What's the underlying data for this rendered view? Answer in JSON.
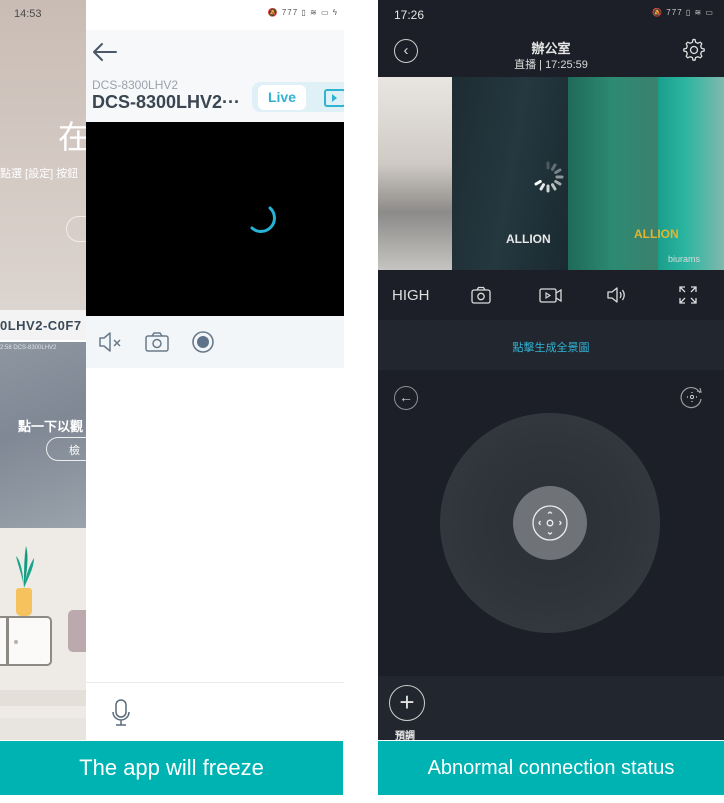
{
  "left_panel": {
    "background_app": {
      "status_time": "14:53",
      "banner_char": "在",
      "banner_hint": "點選 [設定] 按鈕",
      "device_name": "0LHV2-C0F7",
      "thumbnail_timestamp": "2:58  DCS-8300LHV2",
      "tap_hint": "點一下以觀",
      "check_button": "檢"
    },
    "app": {
      "status_icons": "🔕 777 ▯ ≋ ▭ ϟ",
      "back_icon": "arrow-left-icon",
      "device_model": "DCS-8300LHV2",
      "device_title": "DCS-8300LHV2···",
      "tabs": [
        {
          "label": "Live",
          "active": true
        },
        {
          "label": "",
          "icon": "playback-icon",
          "active": false
        }
      ],
      "video_state": "loading",
      "controls": [
        {
          "name": "mute",
          "icon": "speaker-muted-icon"
        },
        {
          "name": "snapshot",
          "icon": "camera-icon"
        },
        {
          "name": "record",
          "icon": "record-icon"
        }
      ],
      "mic_icon": "microphone-icon"
    },
    "caption": "The app will freeze"
  },
  "right_panel": {
    "status_time": "17:26",
    "status_icons": "🔕 777 ▯ ≋ ▭",
    "title": "辦公室",
    "subtitle": "直播 | 17:25:59",
    "video": {
      "state": "loading",
      "brand_text_1": "ALLION",
      "brand_text_2": "ALLION",
      "watermark": "biurams"
    },
    "toolbar": {
      "quality": "HIGH",
      "icons": [
        "camera-icon",
        "video-record-icon",
        "speaker-icon",
        "fullscreen-icon"
      ]
    },
    "panorama_label": "點擊生成全景圖",
    "ptz": {
      "back_icon": "arrow-left-circle-icon",
      "reset_icon": "ptz-reset-icon",
      "joystick_icon": "direction-pad-icon"
    },
    "preset_label": "預調",
    "caption": "Abnormal connection status",
    "colors": {
      "accent": "#2eb4d6",
      "caption_bg": "#00b3b3",
      "dark_bg": "#1c1f27"
    }
  }
}
